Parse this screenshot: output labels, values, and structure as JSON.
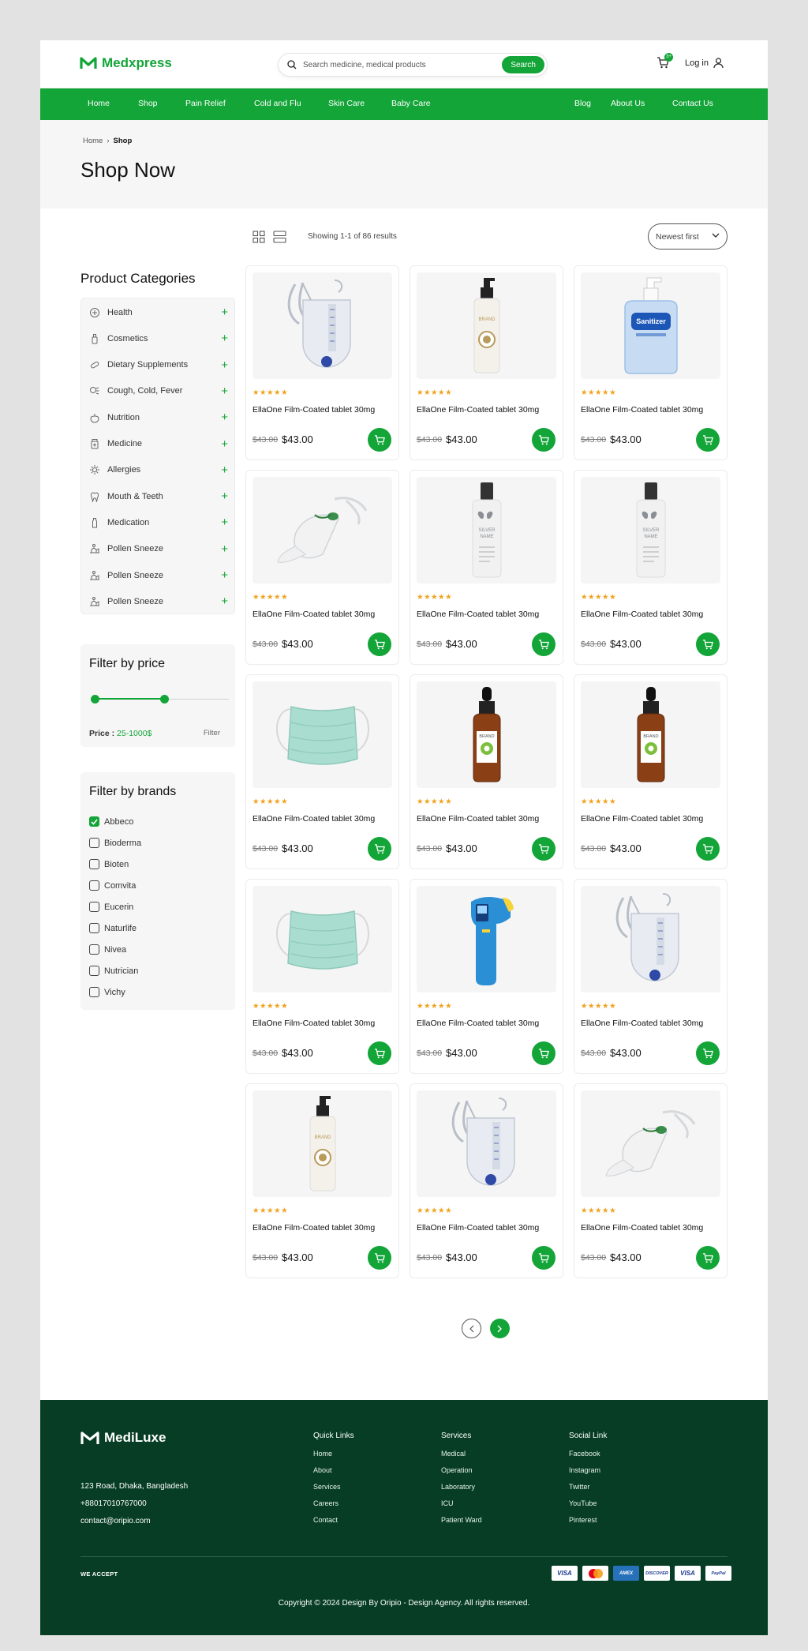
{
  "brand": {
    "name": "Medxpress",
    "accent": "#13a538",
    "footer_bg": "#063d24"
  },
  "search": {
    "placeholder": "Search medicine, medical products",
    "button": "Search"
  },
  "cart": {
    "count": "3+"
  },
  "login": "Log in",
  "nav": {
    "left": [
      "Home",
      "Shop",
      "Pain Relief",
      "Cold and Flu",
      "Skin Care",
      "Baby Care"
    ],
    "right": [
      "Blog",
      "About Us",
      "Contact Us"
    ]
  },
  "breadcrumb": {
    "home": "Home",
    "current": "Shop"
  },
  "page_title": "Shop Now",
  "sidebar": {
    "title": "Product Categories",
    "categories": [
      {
        "label": "Health",
        "icon": "health-icon"
      },
      {
        "label": "Cosmetics",
        "icon": "cosmetics-icon"
      },
      {
        "label": "Dietary Supplements",
        "icon": "supplements-icon"
      },
      {
        "label": "Cough, Cold, Fever",
        "icon": "cough-icon"
      },
      {
        "label": "Nutrition",
        "icon": "nutrition-icon"
      },
      {
        "label": "Medicine",
        "icon": "medicine-icon"
      },
      {
        "label": "Allergies",
        "icon": "allergies-icon"
      },
      {
        "label": "Mouth & Teeth",
        "icon": "tooth-icon"
      },
      {
        "label": "Medication",
        "icon": "medication-icon"
      },
      {
        "label": "Pollen Sneeze",
        "icon": "pollen-icon"
      },
      {
        "label": "Pollen Sneeze",
        "icon": "pollen-icon"
      },
      {
        "label": "Pollen Sneeze",
        "icon": "pollen-icon"
      }
    ]
  },
  "price_filter": {
    "title": "Filter by price",
    "label": "Price :",
    "range": "25-1000$",
    "button": "Filter",
    "min_fraction": 0.0,
    "max_fraction": 0.52
  },
  "brand_filter": {
    "title": "Filter by brands",
    "brands": [
      {
        "label": "Abbeco",
        "checked": true
      },
      {
        "label": "Bioderma",
        "checked": false
      },
      {
        "label": "Bioten",
        "checked": false
      },
      {
        "label": "Comvita",
        "checked": false
      },
      {
        "label": "Eucerin",
        "checked": false
      },
      {
        "label": "Naturlife",
        "checked": false
      },
      {
        "label": "Nivea",
        "checked": false
      },
      {
        "label": "Nutrician",
        "checked": false
      },
      {
        "label": "Vichy",
        "checked": false
      }
    ]
  },
  "results": {
    "showing": "Showing 1-1 of 86 results",
    "sort": "Newest first"
  },
  "products": [
    {
      "image": "urine-bag",
      "name": "EllaOne Film-Coated tablet 30mg",
      "old_price": "$43.00",
      "price": "$43.00",
      "rating": 5
    },
    {
      "image": "pump-bottle",
      "name": "EllaOne Film-Coated tablet 30mg",
      "old_price": "$43.00",
      "price": "$43.00",
      "rating": 5
    },
    {
      "image": "sanitizer",
      "name": "EllaOne Film-Coated tablet 30mg",
      "old_price": "$43.00",
      "price": "$43.00",
      "rating": 5
    },
    {
      "image": "oxygen-mask",
      "name": "EllaOne Film-Coated tablet 30mg",
      "old_price": "$43.00",
      "price": "$43.00",
      "rating": 5
    },
    {
      "image": "silver-bottle",
      "name": "EllaOne Film-Coated tablet 30mg",
      "old_price": "$43.00",
      "price": "$43.00",
      "rating": 5
    },
    {
      "image": "silver-bottle",
      "name": "EllaOne Film-Coated tablet 30mg",
      "old_price": "$43.00",
      "price": "$43.00",
      "rating": 5
    },
    {
      "image": "face-mask",
      "name": "EllaOne Film-Coated tablet 30mg",
      "old_price": "$43.00",
      "price": "$43.00",
      "rating": 5
    },
    {
      "image": "dropper-bottle",
      "name": "EllaOne Film-Coated tablet 30mg",
      "old_price": "$43.00",
      "price": "$43.00",
      "rating": 5
    },
    {
      "image": "dropper-bottle",
      "name": "EllaOne Film-Coated tablet 30mg",
      "old_price": "$43.00",
      "price": "$43.00",
      "rating": 5
    },
    {
      "image": "face-mask",
      "name": "EllaOne Film-Coated tablet 30mg",
      "old_price": "$43.00",
      "price": "$43.00",
      "rating": 5
    },
    {
      "image": "thermometer",
      "name": "EllaOne Film-Coated tablet 30mg",
      "old_price": "$43.00",
      "price": "$43.00",
      "rating": 5
    },
    {
      "image": "urine-bag",
      "name": "EllaOne Film-Coated tablet 30mg",
      "old_price": "$43.00",
      "price": "$43.00",
      "rating": 5
    },
    {
      "image": "pump-bottle",
      "name": "EllaOne Film-Coated tablet 30mg",
      "old_price": "$43.00",
      "price": "$43.00",
      "rating": 5
    },
    {
      "image": "urine-bag",
      "name": "EllaOne Film-Coated tablet 30mg",
      "old_price": "$43.00",
      "price": "$43.00",
      "rating": 5
    },
    {
      "image": "oxygen-mask",
      "name": "EllaOne Film-Coated tablet 30mg",
      "old_price": "$43.00",
      "price": "$43.00",
      "rating": 5
    }
  ],
  "footer": {
    "logo": "MediLuxe",
    "address": "123 Road, Dhaka, Bangladesh",
    "phone": "+88017010767000",
    "email": "contact@oripio.com",
    "columns": [
      {
        "title": "Quick Links",
        "links": [
          "Home",
          "About",
          "Services",
          "Careers",
          "Contact"
        ]
      },
      {
        "title": "Services",
        "links": [
          "Medical",
          "Operation",
          "Laboratory",
          "ICU",
          "Patient Ward"
        ]
      },
      {
        "title": "Social Link",
        "links": [
          "Facebook",
          "Instagram",
          "Twitter",
          "YouTube",
          "Pinterest"
        ]
      }
    ],
    "we_accept": "WE ACCEPT",
    "payments": [
      "VISA",
      "mastercard",
      "AMEX",
      "DISCOVER",
      "VISA",
      "PayPal"
    ],
    "copyright": "Copyright © 2024 Design By Oripio - Design Agency. All rights reserved."
  }
}
